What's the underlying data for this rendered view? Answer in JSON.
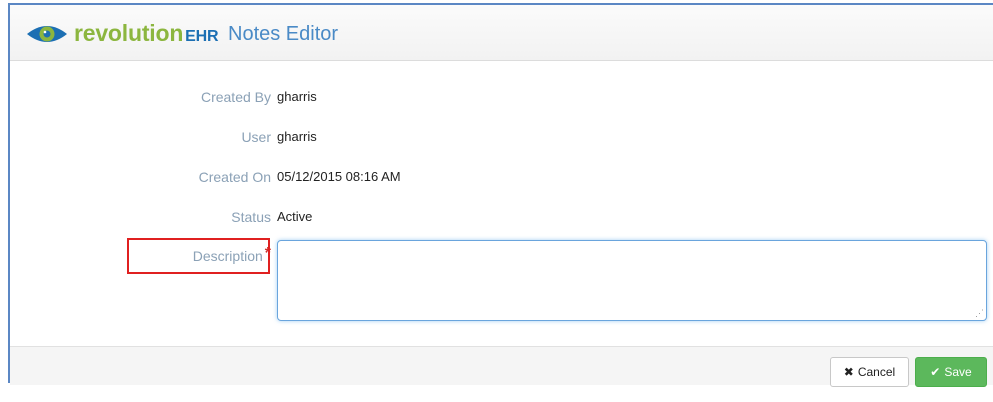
{
  "header": {
    "brand_main": "revolution",
    "brand_suffix": "EHR",
    "title": "Notes Editor",
    "icon": "eye-logo-icon"
  },
  "fields": {
    "created_by": {
      "label": "Created By",
      "value": "gharris"
    },
    "user": {
      "label": "User",
      "value": "gharris"
    },
    "created_on": {
      "label": "Created On",
      "value": "05/12/2015 08:16 AM"
    },
    "status": {
      "label": "Status",
      "value": "Active"
    },
    "description": {
      "label": "Description",
      "required_mark": "*",
      "value": ""
    }
  },
  "footer": {
    "cancel": {
      "label": "Cancel",
      "icon": "close-icon"
    },
    "save": {
      "label": "Save",
      "icon": "check-icon"
    }
  },
  "colors": {
    "brand_green": "#8cb63f",
    "brand_blue": "#1c6fb3",
    "title_blue": "#4a8ac6",
    "label_gray_blue": "#8ba1b6",
    "save_green": "#5cb85c",
    "required_red": "#d0312d",
    "highlight_red": "#e02020"
  }
}
